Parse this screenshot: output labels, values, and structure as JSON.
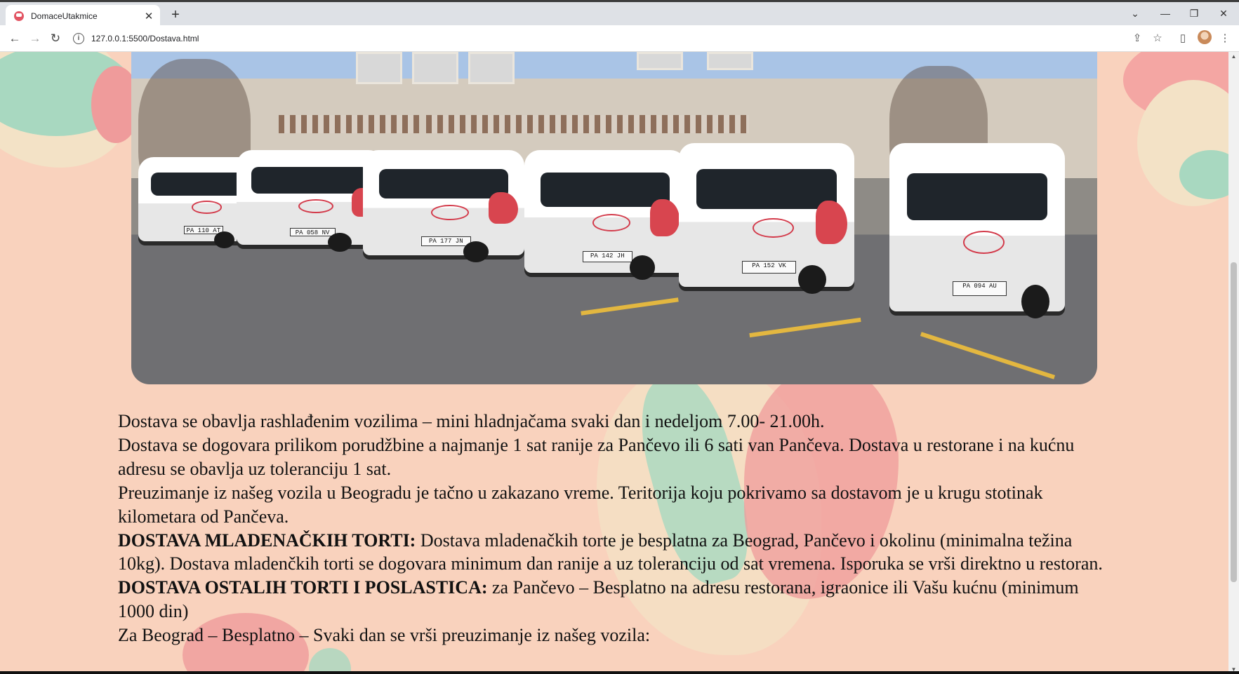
{
  "browser": {
    "tab_title": "DomaceUtakmice",
    "new_tab_label": "+",
    "tab_close_label": "✕",
    "address": "127.0.0.1:5500/Dostava.html",
    "nav": {
      "back": "←",
      "forward": "→",
      "reload": "↻"
    },
    "window_controls": {
      "dropdown": "⌄",
      "minimize": "—",
      "restore": "❐",
      "close": "✕"
    },
    "toolbar_icons": {
      "share": "⇪",
      "bookmark": "☆",
      "sidepanel": "▯",
      "menu": "⋮"
    }
  },
  "hero": {
    "plates": [
      "PA 110 AT",
      "PA 058 NV",
      "PA 177 JN",
      "PA 142 JH",
      "PA 152 VK",
      "PA 094 AU"
    ]
  },
  "content": {
    "p1": "Dostava se obavlja rashlađenim vozilima – mini hladnjačama svaki dan i nedeljom 7.00- 21.00h.",
    "p2": "Dostava se dogovara prilikom porudžbine a najmanje 1 sat ranije za Pančevo ili 6 sati van Pančeva. Dostava u restorane i na kućnu adresu se obavlja uz toleranciju 1 sat.",
    "p3": "Preuzimanje iz našeg vozila u Beogradu je tačno u zakazano vreme. Teritorija koju pokrivamo sa dostavom je u krugu stotinak kilometara od Pančeva.",
    "p4_heading": "DOSTAVA MLADENAČKIH TORTI:",
    "p4_text": " Dostava mladenačkih torte je besplatna za Beograd, Pančevo i okolinu (minimalna težina 10kg). Dostava mladenčkih torti se dogovara minimum dan ranije a uz toleranciju od sat vremena. Isporuka se vrši direktno u restoran.",
    "p5_heading": "DOSTAVA OSTALIH TORTI I POSLASTICA:",
    "p5_text": " za Pančevo – Besplatno na adresu restorana, igraonice ili Vašu kućnu (minimum 1000 din)",
    "p6": "Za Beograd – Besplatno – Svaki dan se vrši preuzimanje iz našeg vozila:"
  },
  "colors": {
    "page_background": "#f9d2bd",
    "accent_red": "#d33b4b",
    "accent_mint": "#a8d8c0"
  }
}
